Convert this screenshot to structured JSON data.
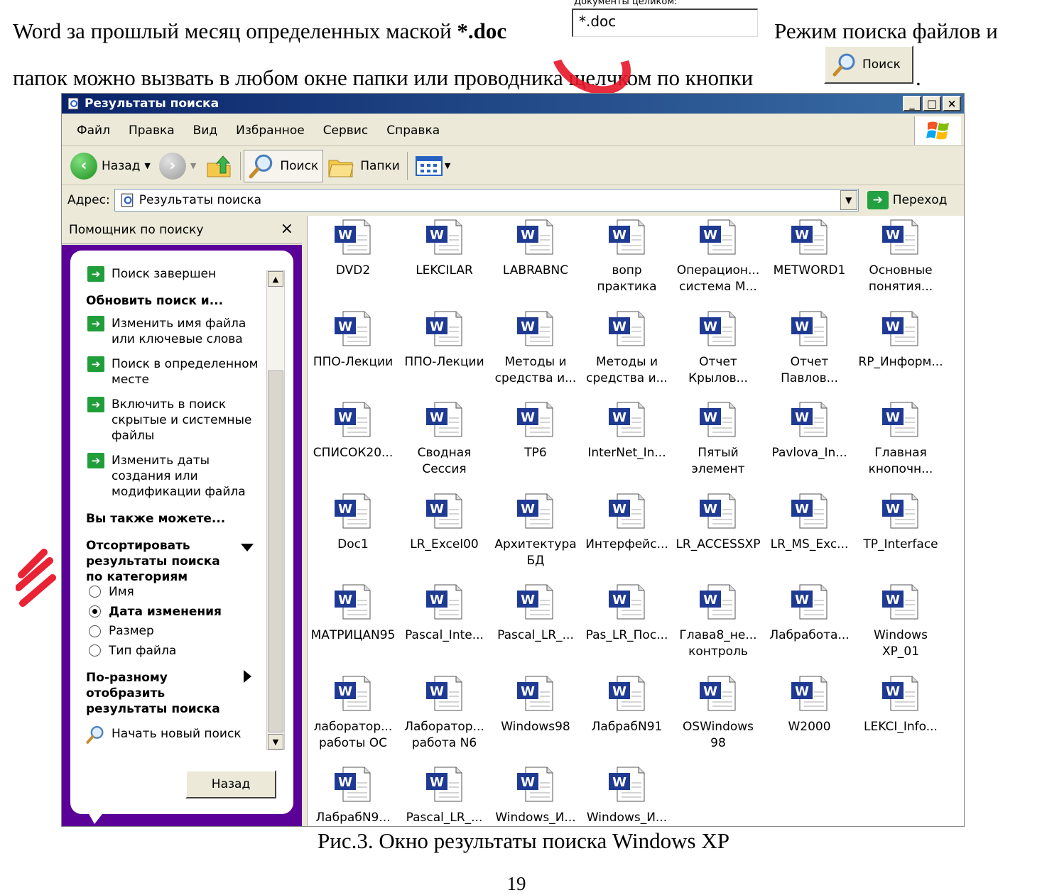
{
  "document": {
    "line1_text": "Word за прошлый месяц определенных маской ",
    "line1_bold": "*.doc",
    "mask_label": "Документы целиком:",
    "mask_value": "*.doc",
    "line1_right": "Режим поиска файлов и",
    "line2_text": "папок можно вызвать в любом окне папки или проводника щелчком по кнопки",
    "search_button_label": "Поиск",
    "line2_end": ".",
    "caption": "Рис.3. Окно результаты поиска Windows XP",
    "page_number": "19"
  },
  "window": {
    "title": "Результаты поиска",
    "controls": {
      "minimize": "_",
      "maximize": "□",
      "close": "×"
    },
    "menu": [
      "Файл",
      "Правка",
      "Вид",
      "Избранное",
      "Сервис",
      "Справка"
    ],
    "toolbar": {
      "back": "Назад",
      "search": "Поиск",
      "folders": "Папки"
    },
    "address": {
      "label": "Адрес:",
      "value": "Результаты поиска",
      "go": "Переход"
    }
  },
  "search_pane": {
    "title": "Помощник по поиску",
    "close": "×",
    "status": "Поиск завершен",
    "refine_heading": "Обновить поиск и...",
    "refine_items": [
      [
        "Изменить имя файла",
        "или ключевые слова"
      ],
      [
        "Поиск в определенном",
        "месте"
      ],
      [
        "Включить в поиск",
        "скрытые и системные",
        "файлы"
      ],
      [
        "Изменить даты",
        "создания или",
        "модификации файла"
      ]
    ],
    "also_heading": "Вы также можете...",
    "sort_heading": [
      "Отсортировать",
      "результаты поиска",
      "по категориям"
    ],
    "sort_options": [
      {
        "label": "Имя",
        "selected": false
      },
      {
        "label": "Дата изменения",
        "selected": true
      },
      {
        "label": "Размер",
        "selected": false
      },
      {
        "label": "Тип файла",
        "selected": false
      }
    ],
    "display_heading": [
      "По-разному",
      "отобразить",
      "результаты поиска"
    ],
    "new_search": "Начать новый поиск",
    "back_button": "Назад"
  },
  "files": [
    "DVD2",
    "LEKCILAR",
    "LABRABNC",
    "вопр\nпрактика",
    "Операцион...\nсистема М...",
    "METWORD1",
    "Основные\nпонятия...",
    "ППО-Лекции",
    "ППО-Лекции",
    "Методы и\nсредства и...",
    "Методы и\nсредства и...",
    "Отчет\nКрылов...",
    "Отчет\nПавлов...",
    "RP_Информ...",
    "СПИСОК20...",
    "Сводная\nСессия",
    "TP6",
    "InterNet_In...",
    "Пятый\nэлемент",
    "Pavlova_In...",
    "Главная\nкнопочн...",
    "Doc1",
    "LR_Excel00",
    "Архитектура\nБД",
    "Интерфейс...",
    "LR_ACCESSXP",
    "LR_MS_Exc...",
    "TP_Interface",
    "МАТРИЦАN95",
    "Pascal_Inte...",
    "Pascal_LR_...",
    "Pas_LR_Пос...",
    "Глава8_не...\nконтроль",
    "Лабработа...",
    "Windows\nXP_01",
    "лаборатор...\nработы ОС",
    "Лаборатор...\nработа N6",
    "Windows98",
    "ЛабрабN91",
    "OSWindows\n98",
    "W2000",
    "LEKCI_Info...",
    "ЛабрабN9...",
    "Pascal_LR_...",
    "Windows_И...",
    "Windows_И..."
  ],
  "colors": {
    "word_icon": "#1f3a93",
    "accent_purple": "#5a0099",
    "watermark": "#e8172a",
    "title_bar": "#0a246a"
  }
}
